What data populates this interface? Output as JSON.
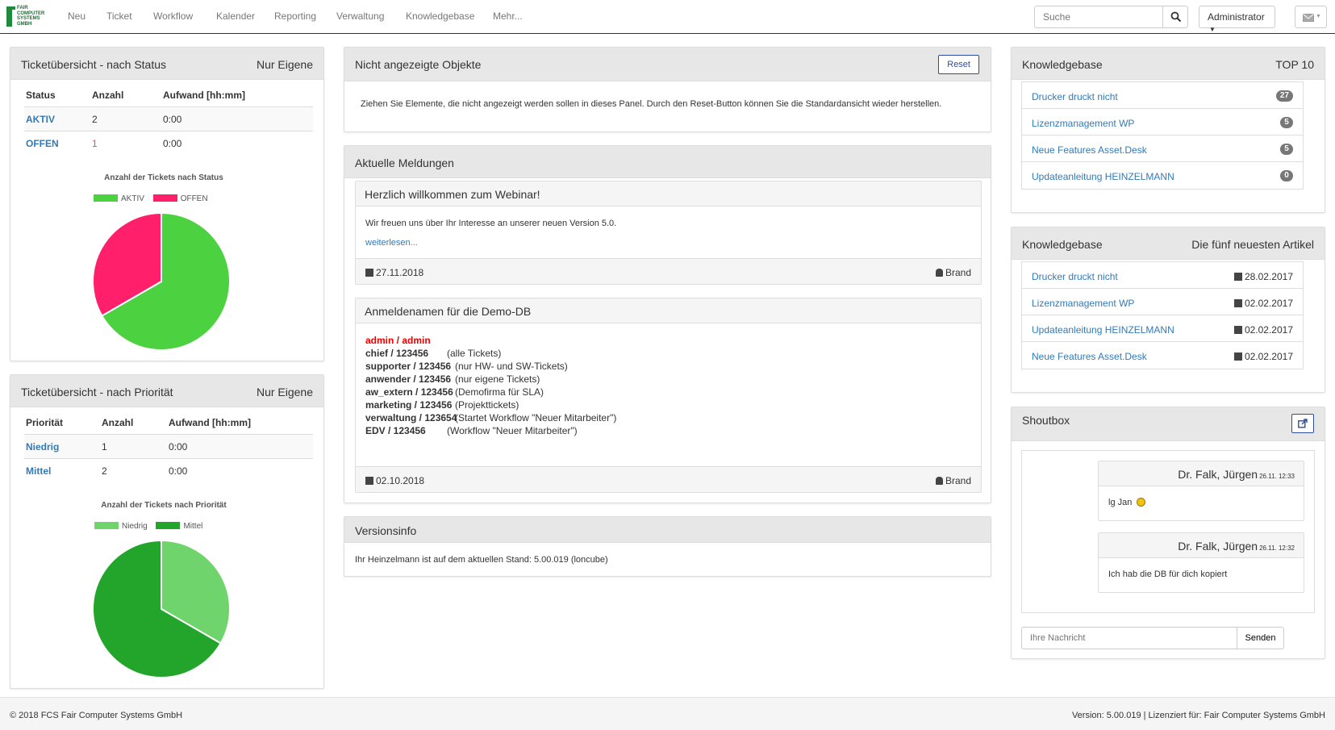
{
  "brand": {
    "logo_text": "FAIR\nCOMPUTER\nSYSTEMS\nGMBH"
  },
  "nav": [
    "Neu",
    "Ticket",
    "Workflow",
    "Kalender",
    "Reporting",
    "Verwaltung",
    "Knowledgebase",
    "Mehr..."
  ],
  "search": {
    "placeholder": "Suche"
  },
  "user": {
    "label": "Administrator"
  },
  "ticket_status": {
    "title": "Ticketübersicht - nach Status",
    "filter": "Nur Eigene",
    "columns": [
      "Status",
      "Anzahl",
      "Aufwand [hh:mm]"
    ],
    "rows": [
      {
        "status": "AKTIV",
        "count": "2",
        "effort": "0:00"
      },
      {
        "status": "OFFEN",
        "count": "1",
        "effort": "0:00"
      }
    ]
  },
  "ticket_priority": {
    "title": "Ticketübersicht - nach Priorität",
    "filter": "Nur Eigene",
    "columns": [
      "Priorität",
      "Anzahl",
      "Aufwand [hh:mm]"
    ],
    "rows": [
      {
        "priority": "Niedrig",
        "count": "1",
        "effort": "0:00"
      },
      {
        "priority": "Mittel",
        "count": "2",
        "effort": "0:00"
      }
    ]
  },
  "chart_data": [
    {
      "type": "pie",
      "title": "Anzahl der Tickets nach Status",
      "categories": [
        "AKTIV",
        "OFFEN"
      ],
      "values": [
        2,
        1
      ],
      "colors": [
        "#4cd140",
        "#ff1f6b"
      ],
      "legend": "top"
    },
    {
      "type": "pie",
      "title": "Anzahl der Tickets nach Priorität",
      "categories": [
        "Niedrig",
        "Mittel"
      ],
      "values": [
        1,
        2
      ],
      "colors": [
        "#6fd46b",
        "#22a52a"
      ],
      "legend": "top"
    }
  ],
  "hidden_objects": {
    "title": "Nicht angezeigte Objekte",
    "reset_label": "Reset",
    "text": "Ziehen Sie Elemente, die nicht angezeigt werden sollen in dieses Panel. Durch den Reset-Button können Sie die Standardansicht wieder herstellen."
  },
  "news": {
    "title": "Aktuelle Meldungen",
    "items": [
      {
        "title": "Herzlich willkommen zum Webinar!",
        "text": "Wir freuen uns über Ihr Interesse an unserer neuen Version 5.0.",
        "more": "weiterlesen...",
        "date": "27.11.2018",
        "author": "Brand"
      },
      {
        "title": "Anmeldenamen für die Demo-DB",
        "admin": "admin / admin",
        "credentials": [
          {
            "login": "chief / 123456",
            "note": "(alle Tickets)"
          },
          {
            "login": "supporter / 123456",
            "note": "(nur HW- und SW-Tickets)"
          },
          {
            "login": "anwender / 123456",
            "note": "(nur eigene Tickets)"
          },
          {
            "login": "aw_extern / 123456",
            "note": "(Demofirma für SLA)"
          },
          {
            "login": "marketing / 123456",
            "note": "(Projekttickets)"
          },
          {
            "login": "verwaltung / 123654",
            "note": "(Startet Workflow \"Neuer Mitarbeiter\")"
          },
          {
            "login": "EDV / 123456",
            "note": "(Workflow \"Neuer Mitarbeiter\")"
          }
        ],
        "date": "02.10.2018",
        "author": "Brand"
      }
    ]
  },
  "version": {
    "title": "Versionsinfo",
    "text": "Ihr Heinzelmann ist auf dem aktuellen Stand: 5.00.019 (loncube)"
  },
  "kb_top": {
    "title": "Knowledgebase",
    "right": "TOP 10",
    "items": [
      {
        "label": "Drucker druckt nicht",
        "count": "27"
      },
      {
        "label": "Lizenzmanagement WP",
        "count": "5"
      },
      {
        "label": "Neue Features Asset.Desk",
        "count": "5"
      },
      {
        "label": "Updateanleitung HEINZELMANN",
        "count": "0"
      }
    ]
  },
  "kb_new": {
    "title": "Knowledgebase",
    "right": "Die fünf neuesten Artikel",
    "items": [
      {
        "label": "Drucker druckt nicht",
        "date": "28.02.2017"
      },
      {
        "label": "Lizenzmanagement WP",
        "date": "02.02.2017"
      },
      {
        "label": "Updateanleitung HEINZELMANN",
        "date": "02.02.2017"
      },
      {
        "label": "Neue Features Asset.Desk",
        "date": "02.02.2017"
      }
    ]
  },
  "shoutbox": {
    "title": "Shoutbox",
    "messages": [
      {
        "author": "Dr. Falk, Jürgen",
        "time": "26.11. 12:33",
        "text": "lg Jan"
      },
      {
        "author": "Dr. Falk, Jürgen",
        "time": "26.11. 12:32",
        "text": "Ich hab die DB für dich kopiert"
      }
    ],
    "input_placeholder": "Ihre Nachricht",
    "send_label": "Senden"
  },
  "footer": {
    "copyright": "© 2018 FCS Fair Computer Systems GmbH",
    "license": "Version: 5.00.019 | Lizenziert für: Fair Computer Systems GmbH"
  }
}
